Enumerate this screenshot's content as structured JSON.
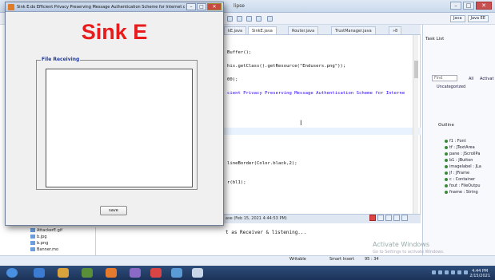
{
  "sink_window": {
    "title": "Sink E:do Efficient Privacy Preserving Message Authentication Scheme for Internet of...",
    "heading": "Sink E",
    "fieldset_legend": "File Receiving",
    "save_label": "save",
    "btn_min": "–",
    "btn_max": "□",
    "btn_close": "✕"
  },
  "ide": {
    "title_fragment": "lipse",
    "perspective": [
      "Java",
      "Java EE"
    ],
    "tabs": [
      {
        "label": "kE.java",
        "active": false
      },
      {
        "label": "SinkE.java",
        "active": true
      },
      {
        "label": "Router.java",
        "active": false
      },
      {
        "label": "TrustManager.java",
        "active": false
      },
      {
        "label": "»8",
        "active": false
      }
    ],
    "code_lines": [
      {
        "text": "Buffer();",
        "kind": "code"
      },
      {
        "text": "his.getClass().getResource(\"Endusers.png\"));",
        "kind": "code"
      },
      {
        "text": "00);",
        "kind": "code"
      },
      {
        "text": "cient Privacy Preserving Message Authentication Scheme for Interne",
        "kind": "str"
      },
      {
        "text": "lineBorder(Color.black,2);",
        "kind": "code"
      },
      {
        "text": "r(bl1);",
        "kind": "code"
      }
    ],
    "console_header": "ase (Feb 15, 2021 4:44:53 PM)",
    "console_output": "t as Receiver & listening...",
    "files": [
      "AttackerE.gif",
      "b.jpg",
      "b.png",
      "Banner.mo"
    ],
    "task_list": {
      "title": "Task List",
      "find": "Find",
      "all": "All",
      "activate": "Activat",
      "uncategorized": "Uncategorized"
    },
    "outline": {
      "title": "Outline",
      "items": [
        "f1 : Font",
        "tf : JTextArea",
        "pane : JScrollPa",
        "b1 : JButton",
        "imagelabel : JLa",
        "jf : JFrame",
        "c : Container",
        "fout : FileOutpu",
        "fname : String"
      ]
    },
    "status": {
      "writable": "Writable",
      "insert": "Smart Insert",
      "position": "95 : 34"
    },
    "activate_windows": "Activate Windows",
    "activate_windows_sub": "Go to Settings to activate Windows."
  },
  "taskbar": {
    "clock_time": "4:44 PM",
    "clock_date": "2/15/2021"
  },
  "colors": {
    "heading_red": "#e81c1c",
    "legend_blue": "#1a3aa8"
  }
}
